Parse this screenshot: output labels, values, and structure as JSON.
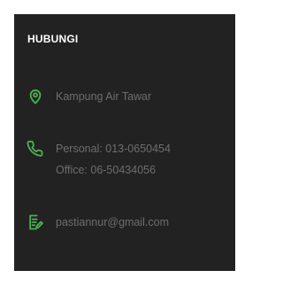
{
  "contact": {
    "heading": "HUBUNGI",
    "address": "Kampung Air Tawar",
    "phone_personal": "Personal: 013-0650454",
    "phone_office": "Office: 06-50434056",
    "email": "pastiannur@gmail.com"
  },
  "icons": {
    "location": "map-pin-icon",
    "phone": "phone-icon",
    "email": "edit-document-icon"
  },
  "colors": {
    "panel_bg": "#222222",
    "accent": "#4caf50",
    "heading_text": "#ffffff",
    "body_text": "#6d6d6d"
  }
}
